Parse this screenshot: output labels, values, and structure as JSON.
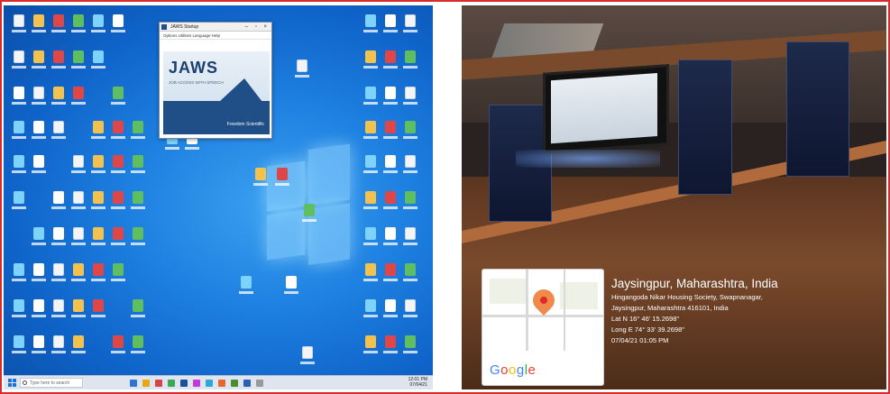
{
  "desktop": {
    "jaws_window": {
      "title": "JAWS Startup",
      "menu": "Options  Utilities  Language  Help",
      "logo": "JAWS",
      "subtitle": "JOB ACCESS WITH SPEECH",
      "brand": "Freedom Scientific"
    },
    "taskbar": {
      "search_placeholder": "Type here to search",
      "time": "12:01 PM",
      "date": "07/04/21"
    }
  },
  "photo": {
    "map": {
      "google_logo": "Google"
    },
    "geotag": {
      "location_title": "Jaysingpur, Maharashtra, India",
      "address_line1": "Hingangoda Nikar Housing Society, Swapnanagar,",
      "address_line2": "Jaysingpur, Maharashtra 416101, India",
      "latitude": "Lat N 16° 46' 15.2698\"",
      "longitude": "Long E 74° 33' 39.2698\"",
      "timestamp": "07/04/21 01:05 PM"
    }
  },
  "colors": {
    "frame_border": "#d92b2b",
    "desktop_blue": "#1d7fe0",
    "pin_orange": "#f08a4b"
  }
}
